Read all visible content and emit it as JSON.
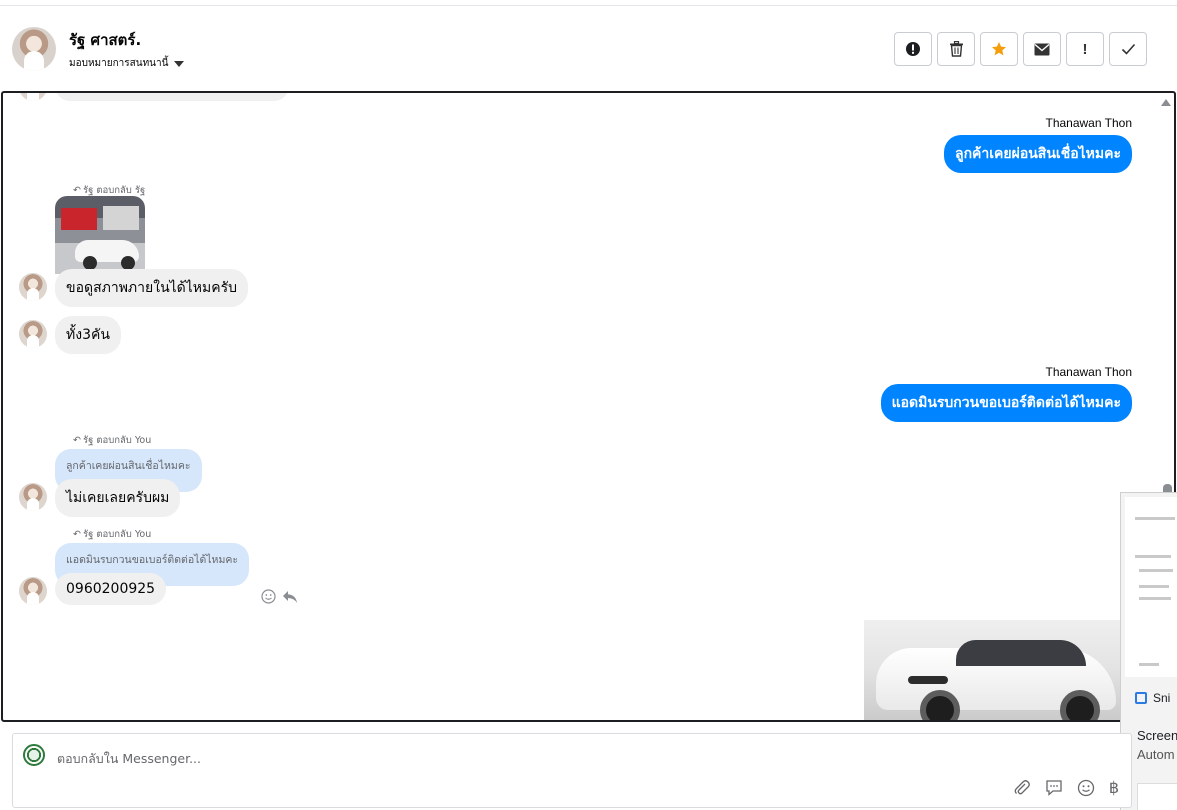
{
  "header": {
    "contact_name": "รัฐ ศาสตร์.",
    "assign_label": "มอบหมายการสนทนานี้",
    "actions": [
      {
        "icon": "alert-circle-icon"
      },
      {
        "icon": "trash-icon"
      },
      {
        "icon": "star-icon",
        "color": "#f59e0b"
      },
      {
        "icon": "mail-icon"
      },
      {
        "icon": "exclamation-icon",
        "label": "!"
      },
      {
        "icon": "check-icon"
      }
    ]
  },
  "messages": {
    "out1": {
      "sender": "Thanawan Thon",
      "text": "ลูกค้าเคยผ่อนสินเชื่อไหมคะ"
    },
    "in1": {
      "reply_note": "รัฐ ตอบกลับ รัฐ",
      "text": "ขอดูสภาพภายในได้ไหมครับ"
    },
    "in2": {
      "text": "ทั้ง3คัน"
    },
    "out2": {
      "sender": "Thanawan Thon",
      "text": "แอดมินรบกวนขอเบอร์ติดต่อได้ไหมคะ"
    },
    "in3": {
      "reply_note": "รัฐ ตอบกลับ You",
      "quote": "ลูกค้าเคยผ่อนสินเชื่อไหมคะ",
      "text": "ไม่เคยเลยครับผม"
    },
    "in4": {
      "reply_note": "รัฐ ตอบกลับ You",
      "quote": "แอดมินรบกวนขอเบอร์ติดต่อได้ไหมคะ",
      "text": "0960200925"
    }
  },
  "popup": {
    "app_label": "Sni",
    "line1": "Screen",
    "line2": "Autom"
  },
  "composer": {
    "placeholder": "ตอบกลับใน Messenger...",
    "currency_symbol": "฿"
  },
  "colors": {
    "outgoing_bubble": "#0084ff",
    "incoming_bubble": "#f0f0f0",
    "quote_bubble": "#d6e6fb"
  }
}
